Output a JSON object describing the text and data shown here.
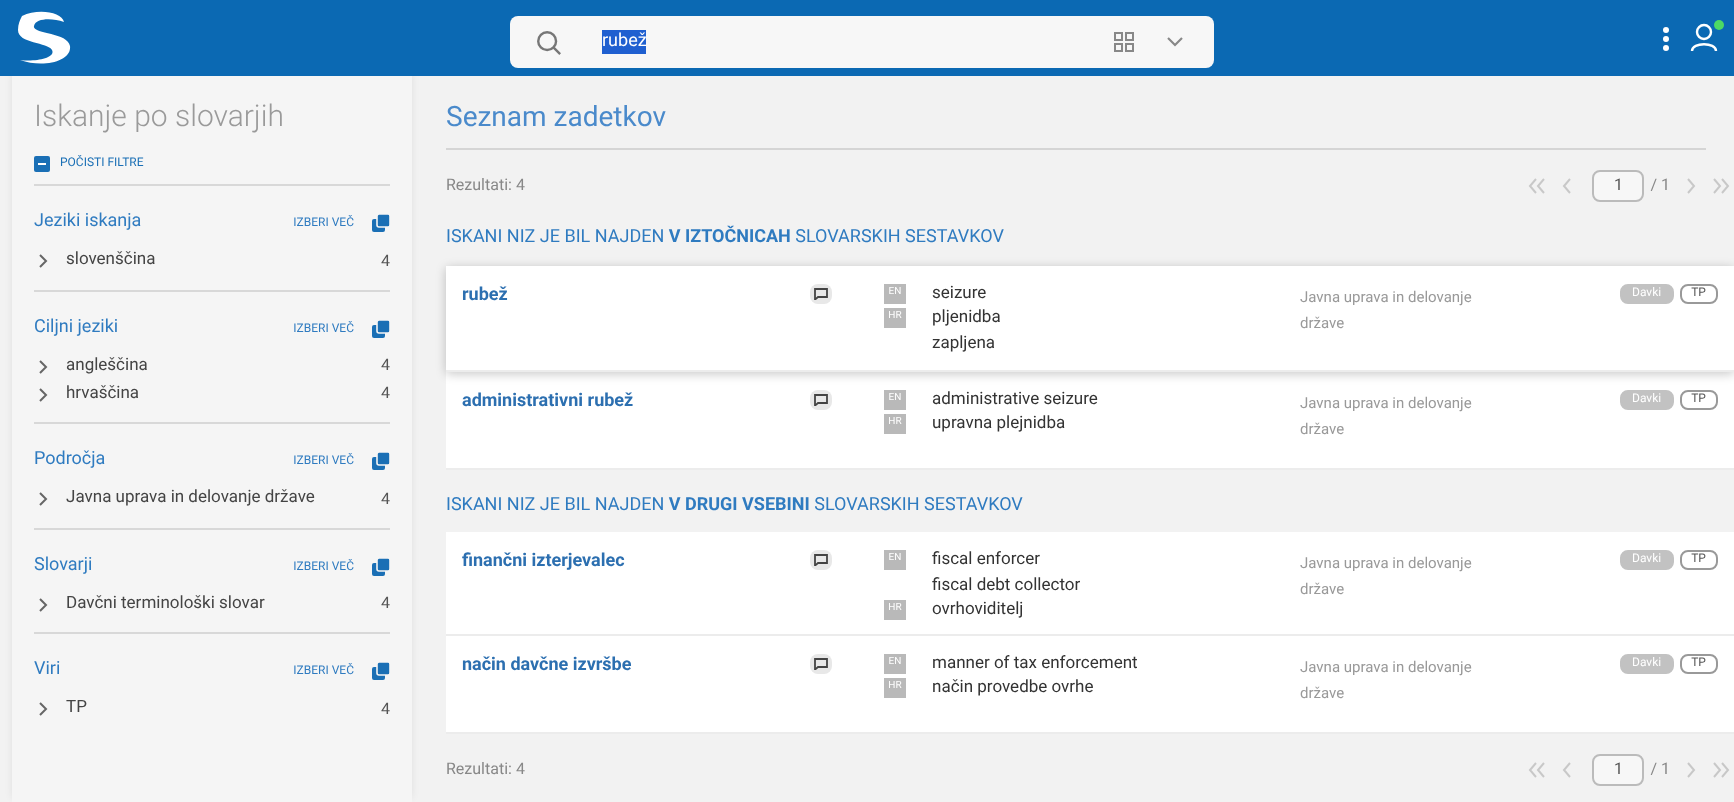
{
  "header": {
    "search": {
      "value": "rubež",
      "value_selected": true
    },
    "user_online": true
  },
  "sidebar": {
    "title": "Iskanje po slovarjih",
    "clear_filters": "POČISTI FILTRE",
    "groups": [
      {
        "title": "Jeziki iskanja",
        "action": "IZBERI VEČ",
        "items": [
          {
            "label": "slovenščina",
            "count": "4"
          }
        ]
      },
      {
        "title": "Ciljni jeziki",
        "action": "IZBERI VEČ",
        "items": [
          {
            "label": "angleščina",
            "count": "4"
          },
          {
            "label": "hrvaščina",
            "count": "4"
          }
        ]
      },
      {
        "title": "Področja",
        "action": "IZBERI VEČ",
        "items": [
          {
            "label": "Javna uprava in delovanje države",
            "count": "4"
          }
        ]
      },
      {
        "title": "Slovarji",
        "action": "IZBERI VEČ",
        "items": [
          {
            "label": "Davčni terminološki slovar",
            "count": "4"
          }
        ]
      },
      {
        "title": "Viri",
        "action": "IZBERI VEČ",
        "items": [
          {
            "label": "TP",
            "count": "4"
          }
        ]
      }
    ]
  },
  "main": {
    "title": "Seznam zadetkov",
    "top_pager": {
      "results": "Rezultati: 4",
      "page": "1",
      "total": "/ 1"
    },
    "sections": [
      {
        "heading": "ISKANI NIZ JE BIL NAJDEN **V IZTOČNICAH** SLOVARSKIH SESTAVKOV",
        "results": [
          {
            "term": "rubež",
            "selected": true,
            "translations": [
              {
                "lang": "EN",
                "terms": [
                  "seizure"
                ]
              },
              {
                "lang": "HR",
                "terms": [
                  "pljenidba",
                  "zapljena"
                ]
              }
            ],
            "domain": "Javna uprava in delovanje države",
            "tags": [
              {
                "label": "Davki",
                "kind": "filled"
              },
              {
                "label": "TP",
                "kind": "outlined"
              }
            ]
          },
          {
            "term": "administrativni rubež",
            "selected": false,
            "translations": [
              {
                "lang": "EN",
                "terms": [
                  "administrative seizure"
                ]
              },
              {
                "lang": "HR",
                "terms": [
                  "upravna plejnidba"
                ]
              }
            ],
            "domain": "Javna uprava in delovanje države",
            "tags": [
              {
                "label": "Davki",
                "kind": "filled"
              },
              {
                "label": "TP",
                "kind": "outlined"
              }
            ]
          }
        ]
      },
      {
        "heading": "ISKANI NIZ JE BIL NAJDEN **V DRUGI VSEBINI** SLOVARSKIH SESTAVKOV",
        "results": [
          {
            "term": "finančni izterjevalec",
            "selected": false,
            "translations": [
              {
                "lang": "EN",
                "terms": [
                  "fiscal enforcer",
                  "fiscal debt collector"
                ]
              },
              {
                "lang": "HR",
                "terms": [
                  "ovrhoviditelj"
                ]
              }
            ],
            "domain": "Javna uprava in delovanje države",
            "tags": [
              {
                "label": "Davki",
                "kind": "filled"
              },
              {
                "label": "TP",
                "kind": "outlined"
              }
            ]
          },
          {
            "term": "način davčne izvršbe",
            "selected": false,
            "translations": [
              {
                "lang": "EN",
                "terms": [
                  "manner of tax enforcement"
                ]
              },
              {
                "lang": "HR",
                "terms": [
                  "način provedbe ovrhe"
                ]
              }
            ],
            "domain": "Javna uprava in delovanje države",
            "tags": [
              {
                "label": "Davki",
                "kind": "filled"
              },
              {
                "label": "TP",
                "kind": "outlined"
              }
            ]
          }
        ]
      }
    ],
    "bottom_pager": {
      "results": "Rezultati: 4",
      "page": "1",
      "total": "/ 1"
    }
  }
}
